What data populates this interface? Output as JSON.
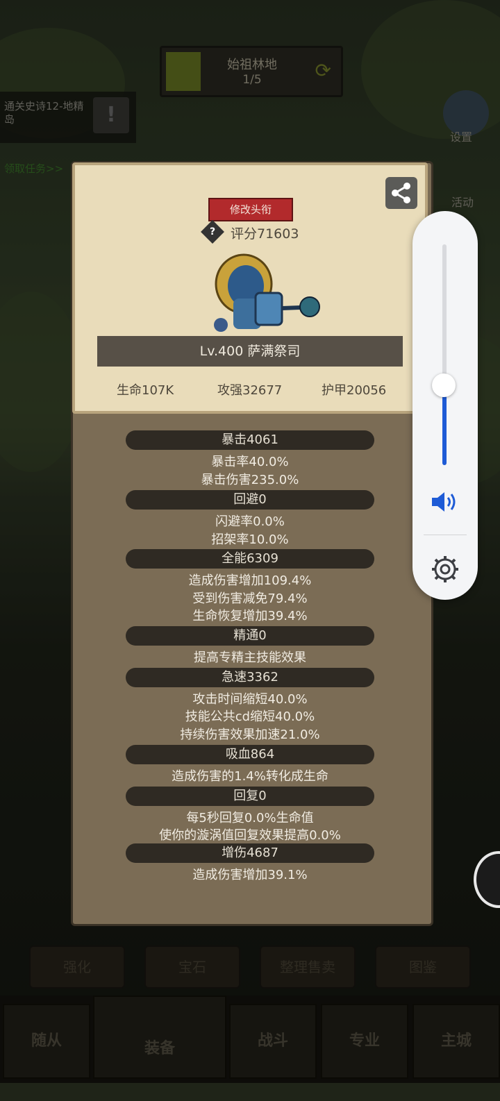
{
  "map": {
    "name": "始祖林地",
    "progress": "1/5"
  },
  "quest": {
    "text": "通关史诗12-地精岛",
    "button_icon": "!",
    "link": "领取任务>>"
  },
  "side": {
    "settings_label": "设置",
    "activity_label": "活动"
  },
  "bottom_actions": [
    "强化",
    "宝石",
    "整理售卖",
    "图鉴"
  ],
  "tabs": [
    "随从",
    "装备",
    "战斗",
    "专业",
    "主城"
  ],
  "modal": {
    "rename_button": "修改头衔",
    "score_icon": "?",
    "score": "评分71603",
    "hero_name": "Lv.400 萨满祭司",
    "hp": "生命107K",
    "atk": "攻强32677",
    "armor": "护甲20056",
    "sections": [
      {
        "title": "暴击4061",
        "lines": [
          "暴击率40.0%",
          "暴击伤害235.0%"
        ]
      },
      {
        "title": "回避0",
        "lines": [
          "闪避率0.0%",
          "招架率10.0%"
        ]
      },
      {
        "title": "全能6309",
        "lines": [
          "造成伤害增加109.4%",
          "受到伤害减免79.4%",
          "生命恢复增加39.4%"
        ]
      },
      {
        "title": "精通0",
        "lines": [
          "提高专精主技能效果"
        ]
      },
      {
        "title": "急速3362",
        "lines": [
          "攻击时间缩短40.0%",
          "技能公共cd缩短40.0%",
          "持续伤害效果加速21.0%"
        ]
      },
      {
        "title": "吸血864",
        "lines": [
          "造成伤害的1.4%转化成生命"
        ]
      },
      {
        "title": "回复0",
        "lines": [
          "每5秒回复0.0%生命值",
          "使你的漩涡值回复效果提高0.0%"
        ]
      },
      {
        "title": "增伤4687",
        "lines": [
          "造成伤害增加39.1%"
        ]
      }
    ]
  },
  "volume": {
    "level": 0.36,
    "accent": "#1e5bd6"
  },
  "colors": {
    "card": "#e9dcba",
    "modal": "#7b6c55",
    "section_bar": "#2f2a23",
    "rename": "#b22a2c"
  }
}
